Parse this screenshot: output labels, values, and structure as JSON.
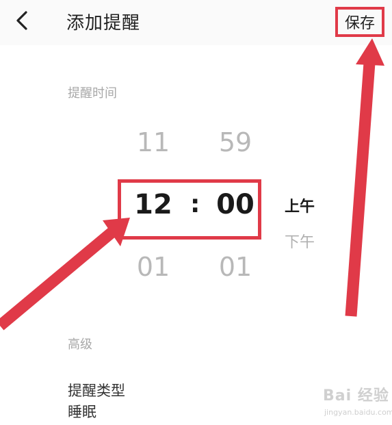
{
  "header": {
    "back_icon": "chevron-left-icon",
    "title": "添加提醒",
    "save_label": "保存"
  },
  "reminder_time": {
    "label": "提醒时间",
    "hour_prev": "11",
    "hour_selected": "12",
    "hour_next": "01",
    "separator": ":",
    "minute_prev": "59",
    "minute_selected": "00",
    "minute_next": "01",
    "am_label": "上午",
    "pm_label": "下午"
  },
  "advanced": {
    "label": "高级",
    "reminder_type_label": "提醒类型",
    "reminder_type_value": "睡眠"
  },
  "watermark": {
    "brand": "Bai 经验",
    "url": "jingyan.baidu.com"
  },
  "annotation": {
    "color": "#e03a48"
  }
}
